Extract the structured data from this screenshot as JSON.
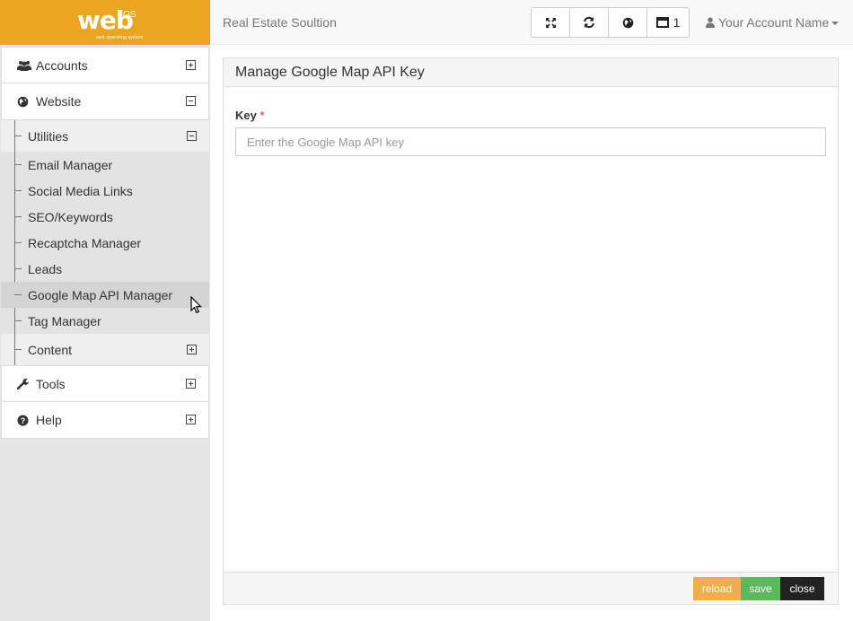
{
  "brand": {
    "logo_text": "web",
    "logo_super": "OS",
    "logo_tagline": "web operating system",
    "color": "#eaa620"
  },
  "header": {
    "app_title": "Real Estate Soultion",
    "buttons": [
      {
        "icon": "fullscreen-icon"
      },
      {
        "icon": "refresh-icon"
      },
      {
        "icon": "globe-icon"
      },
      {
        "icon": "window-icon",
        "count": "1"
      }
    ],
    "account_name": "Your Account Name"
  },
  "sidebar": {
    "items": [
      {
        "label": "Accounts",
        "icon": "users-icon",
        "expanded": false
      },
      {
        "label": "Website",
        "icon": "globe-icon",
        "expanded": true,
        "children": [
          {
            "label": "Utilities",
            "expanded": true,
            "children": [
              {
                "label": "Email Manager"
              },
              {
                "label": "Social Media Links"
              },
              {
                "label": "SEO/Keywords"
              },
              {
                "label": "Recaptcha Manager"
              },
              {
                "label": "Leads"
              },
              {
                "label": "Google Map API Manager",
                "active": true
              },
              {
                "label": "Tag Manager"
              }
            ]
          },
          {
            "label": "Content",
            "expanded": false
          }
        ]
      },
      {
        "label": "Tools",
        "icon": "wrench-icon",
        "expanded": false
      },
      {
        "label": "Help",
        "icon": "question-circle-icon",
        "expanded": false
      }
    ]
  },
  "panel": {
    "title": "Manage Google Map API Key",
    "key_label": "Key",
    "required_mark": "*",
    "key_value": "",
    "key_placeholder": "Enter the Google Map API key",
    "buttons": {
      "reload": "reload",
      "save": "save",
      "close": "close"
    },
    "colors": {
      "reload": "#f0ad4e",
      "save": "#5cb85c",
      "close": "#222222"
    }
  }
}
